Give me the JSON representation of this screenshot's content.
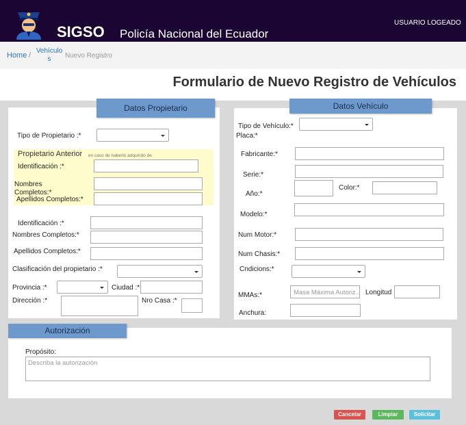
{
  "header": {
    "app_title": "SIGSO",
    "subtitle": "Policía Nacional del Ecuador",
    "user": "USUARIO LOGEADO"
  },
  "breadcrumb": {
    "home": "Home",
    "separator": "/",
    "section": "Vehículo s",
    "current": "Nuevo Registro"
  },
  "page_title": "Formulario de Nuevo Registro de Vehículos",
  "propietario": {
    "tab": "Datos Propietario",
    "tipo_label": "Tipo de Propietario :*",
    "anterior_title": "Propietario Anterior",
    "anterior_note": "en caso de haberlo adquirido de",
    "anterior_id_label": "Identificación :*",
    "anterior_nombres_label": "Nombres Completos:*",
    "anterior_apellidos_label": "Apellidos Completos:*",
    "id_label": "Identificación :*",
    "nombres_label": "Nombres Completos:*",
    "apellidos_label": "Apellidos Completos:*",
    "clasificacion_label": "Clasificación del propietario :*",
    "provincia_label": "Provincia :*",
    "ciudad_label": "Ciudad :*",
    "direccion_label": "Dirección :*",
    "nro_casa_label": "Nro Casa :*"
  },
  "vehiculo": {
    "tab": "Datos Vehículo",
    "tipo_label": "Tipo de Vehículo:*",
    "placa_label": "Placa:*",
    "fabricante_label": "Fabricante:*",
    "serie_label": "Serie:*",
    "anio_label": "Año:*",
    "color_label": "Color:*",
    "modelo_label": "Modelo:*",
    "motor_label": "Num Motor:*",
    "chasis_label": "Num Chasis:*",
    "condiciones_label": "Cndicions:*",
    "mmas_label": "MMAs:*",
    "mmas_placeholder": "Masa Máxima Autoriz...",
    "longitud_label": "Longitud",
    "anchura_label": "Anchura:"
  },
  "autorizacion": {
    "tab": "Autorización",
    "proposito_label": "Propósito:",
    "proposito_placeholder": "Describa la autorización"
  },
  "actions": {
    "cancel": "Cancelar",
    "clear": "Limpiar",
    "submit": "Solicitar"
  },
  "colors": {
    "header_bg": "#1a0533",
    "tab_bg": "#6d99cc",
    "highlight_bg": "#fefccd",
    "cancel": "#d9534f",
    "clear": "#5cb85c",
    "submit": "#5bc0de"
  },
  "icons": {
    "logo": "police-officer-icon",
    "select_caret": "chevron-down-icon"
  }
}
